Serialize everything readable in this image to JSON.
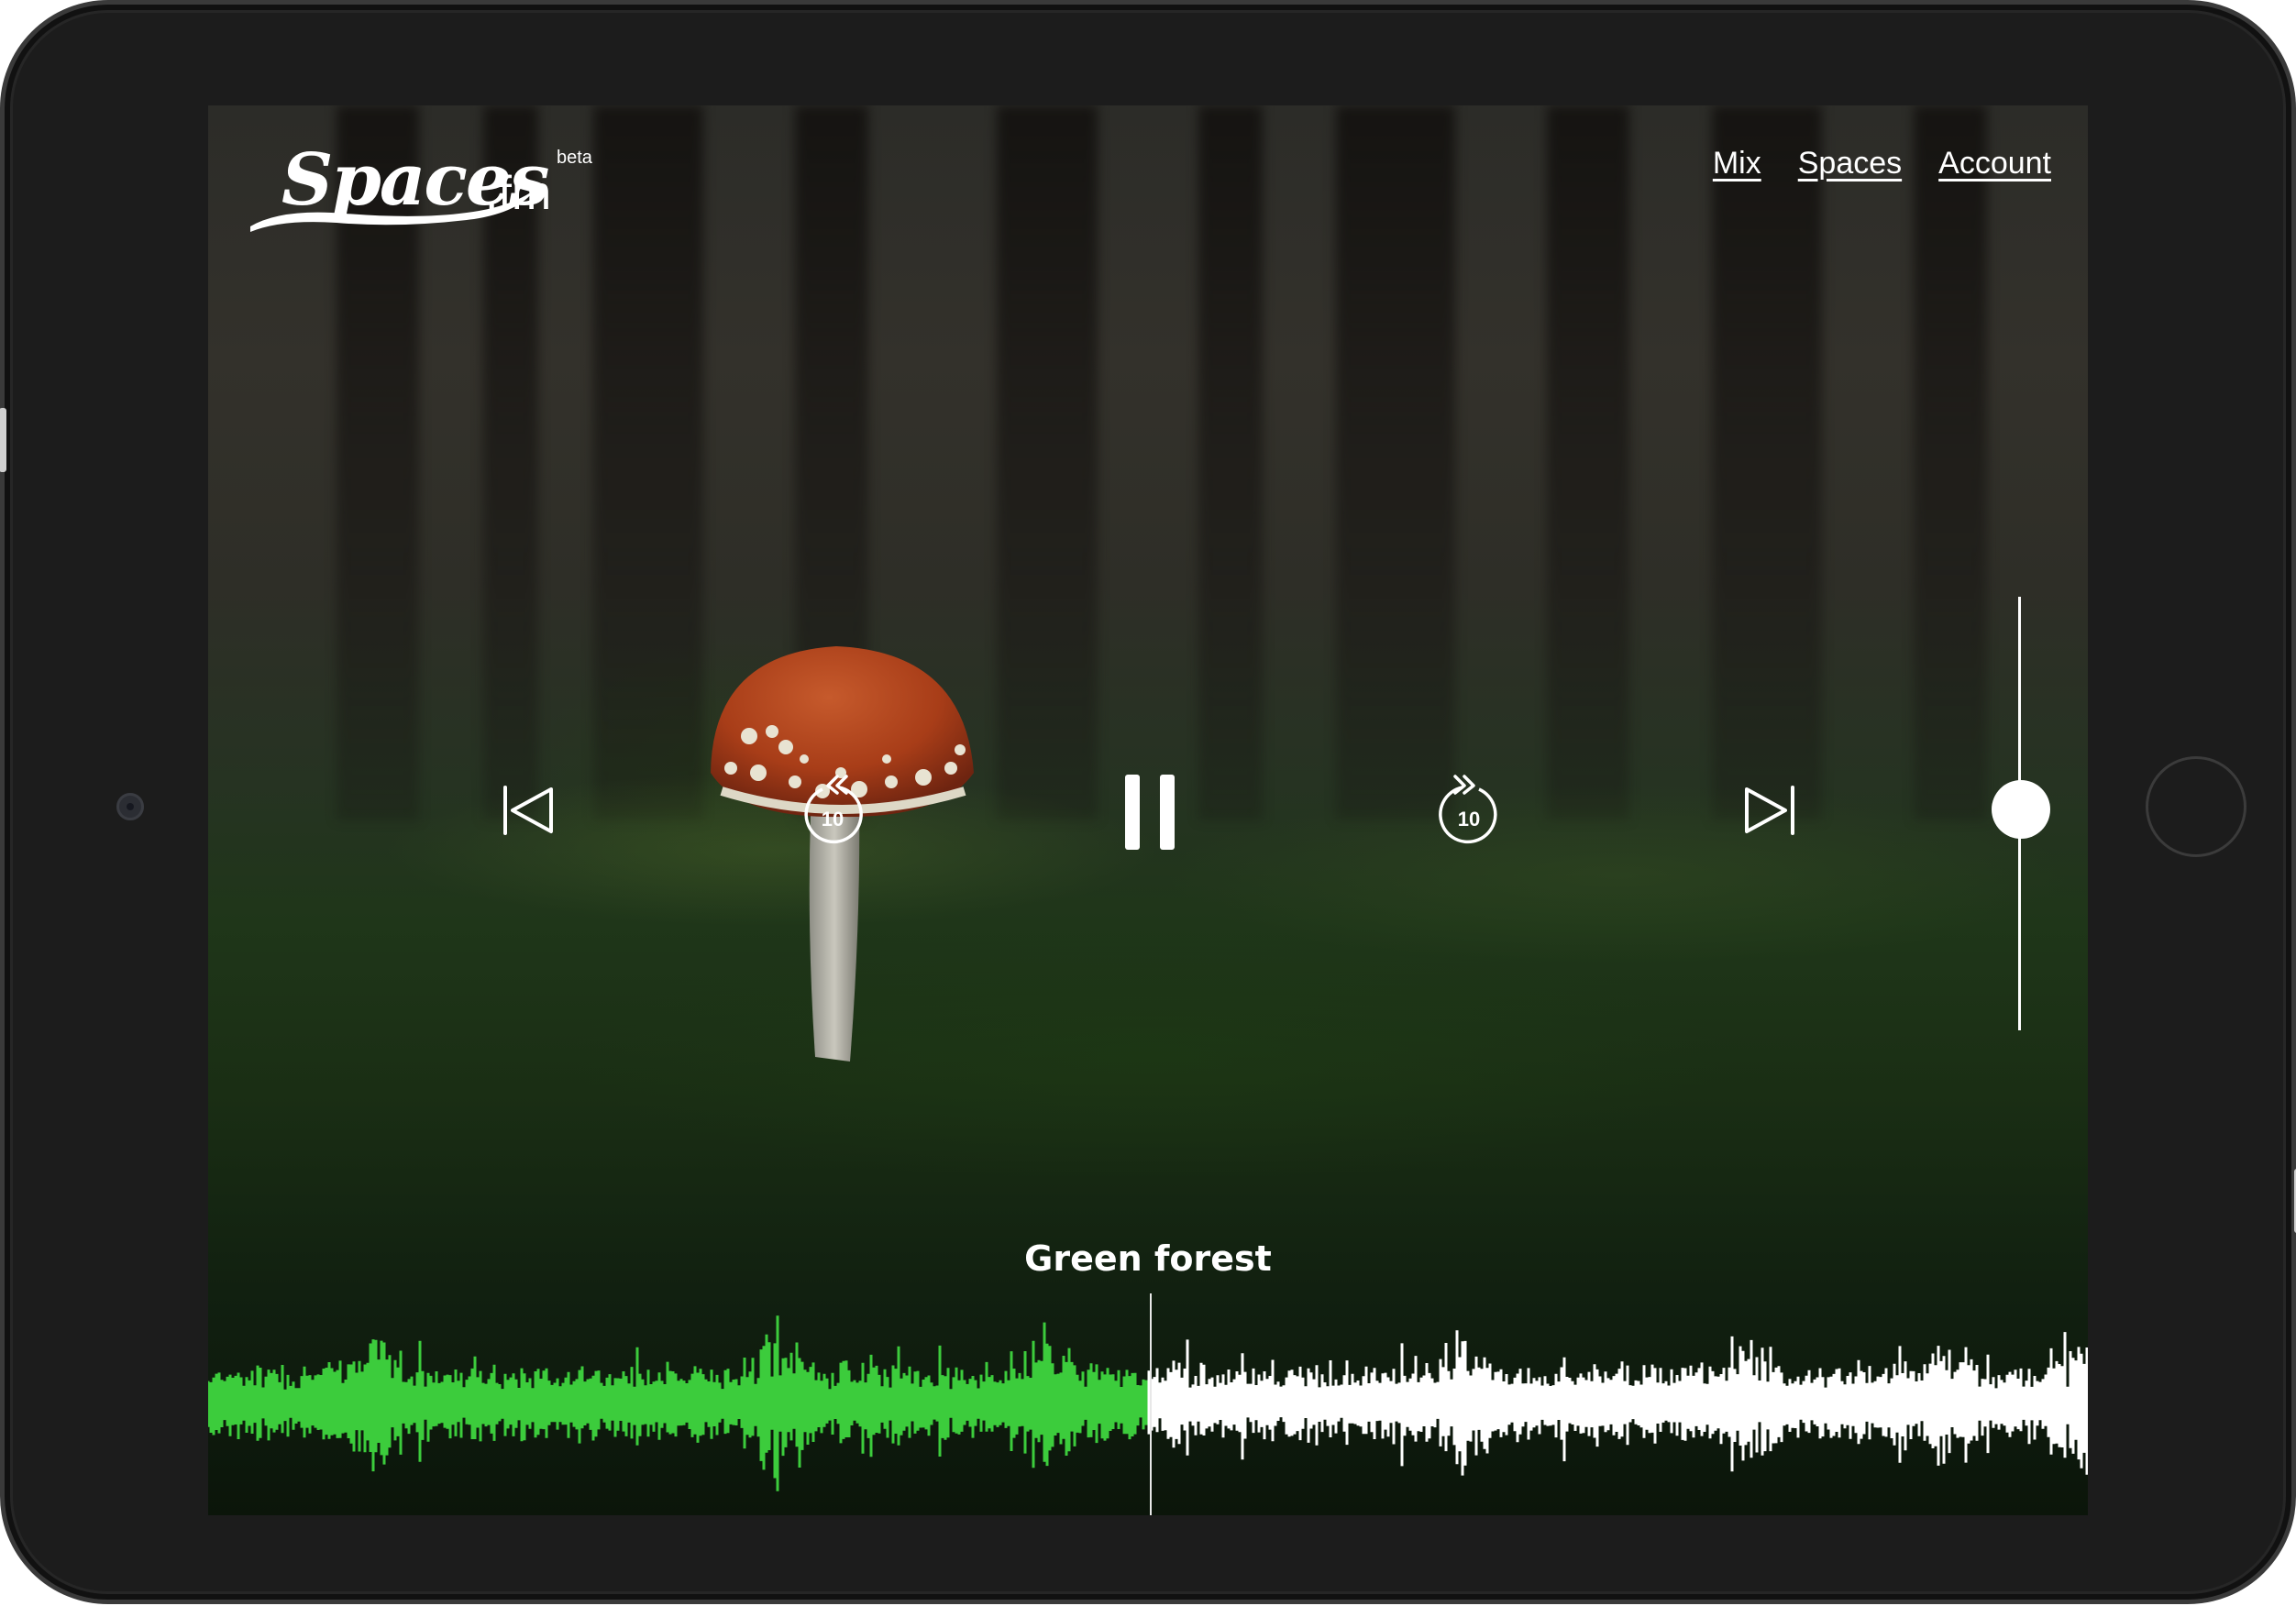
{
  "app": {
    "logo": {
      "name": "Spaces",
      "suffix": ".fm",
      "badge": "beta"
    },
    "nav": [
      {
        "label": "Mix"
      },
      {
        "label": "Spaces"
      },
      {
        "label": "Account"
      }
    ]
  },
  "player": {
    "track_title": "Green forest",
    "skip_back_seconds": "10",
    "skip_forward_seconds": "10",
    "state": "playing",
    "progress": 0.5,
    "volume": 0.5
  },
  "colors": {
    "played_waveform": "#3ccc3c",
    "unplayed_waveform": "#ffffff",
    "device_bezel": "#1c1c1c"
  },
  "icons": {
    "previous": "skip-previous-icon",
    "rewind": "replay-10-icon",
    "pause": "pause-icon",
    "forward": "forward-10-icon",
    "next": "skip-next-icon"
  }
}
